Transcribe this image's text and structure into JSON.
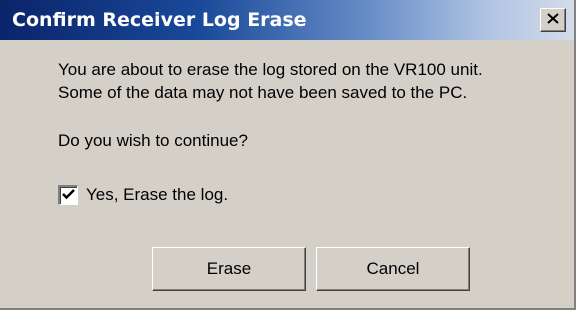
{
  "window": {
    "title": "Confirm Receiver Log Erase",
    "close_icon": "close-x-icon"
  },
  "message": {
    "line1": "You are about to erase the log stored on the VR100 unit.",
    "line2": "Some of the data may not have been saved to the PC.",
    "question": "Do you wish to continue?"
  },
  "checkbox": {
    "label": "Yes, Erase the log.",
    "checked": true
  },
  "buttons": {
    "erase_label": "Erase",
    "cancel_label": "Cancel"
  },
  "colors": {
    "titlebar_start": "#0a246a",
    "titlebar_end": "#d4dce8",
    "face": "#d4d0c8"
  }
}
